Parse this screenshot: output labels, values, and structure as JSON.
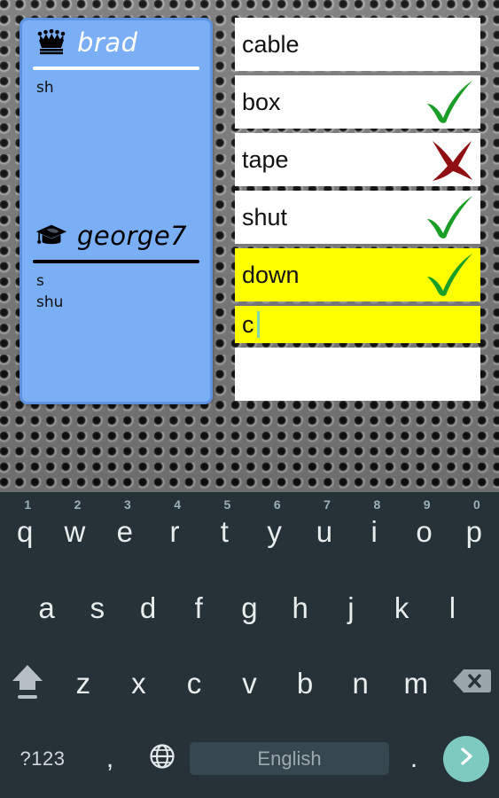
{
  "background": {
    "texture": "perforated-metal-grille",
    "base_color": "#8a8a8a"
  },
  "players_panel": {
    "panel_color": "#7aaef5",
    "border_color": "#5d93e0",
    "players": [
      {
        "icon": "crown-icon",
        "role": "leader",
        "name": "brad",
        "name_color": "#ffffff",
        "guesses": [
          "sh"
        ]
      },
      {
        "icon": "graduation-cap-icon",
        "role": "student",
        "name": "george7",
        "name_color": "#000000",
        "guesses": [
          "s",
          "shu"
        ]
      }
    ]
  },
  "word_list": {
    "rows": [
      {
        "word": "cable",
        "mark": "none",
        "state": "normal",
        "editing": false
      },
      {
        "word": "box",
        "mark": "check",
        "state": "normal",
        "editing": false
      },
      {
        "word": "tape",
        "mark": "cross",
        "state": "normal",
        "editing": false
      },
      {
        "word": "shut",
        "mark": "check",
        "state": "normal",
        "editing": false
      },
      {
        "word": "down",
        "mark": "check",
        "state": "highlight",
        "editing": false
      },
      {
        "word": "c",
        "mark": "none",
        "state": "highlight",
        "editing": true
      },
      {
        "word": "",
        "mark": "none",
        "state": "normal",
        "editing": false
      }
    ],
    "highlight_color": "#ffff00",
    "check_color": "#1a9e28",
    "cross_color": "#8f0f12",
    "caret_color": "#7fd6a8"
  },
  "keyboard": {
    "background_color": "#263238",
    "row1": [
      {
        "key": "q",
        "hint": "1"
      },
      {
        "key": "w",
        "hint": "2"
      },
      {
        "key": "e",
        "hint": "3"
      },
      {
        "key": "r",
        "hint": "4"
      },
      {
        "key": "t",
        "hint": "5"
      },
      {
        "key": "y",
        "hint": "6"
      },
      {
        "key": "u",
        "hint": "7"
      },
      {
        "key": "i",
        "hint": "8"
      },
      {
        "key": "o",
        "hint": "9"
      },
      {
        "key": "p",
        "hint": "0"
      }
    ],
    "row2": [
      "a",
      "s",
      "d",
      "f",
      "g",
      "h",
      "j",
      "k",
      "l"
    ],
    "row3": [
      "z",
      "x",
      "c",
      "v",
      "b",
      "n",
      "m"
    ],
    "shift_icon": "shift-arrow-icon",
    "backspace_icon": "backspace-icon",
    "row4": {
      "symbols_label": "?123",
      "comma_label": ",",
      "globe_icon": "globe-icon",
      "space_label": "English",
      "period_label": ".",
      "enter_icon": "chevron-right-icon",
      "enter_color": "#7ecac0"
    }
  }
}
